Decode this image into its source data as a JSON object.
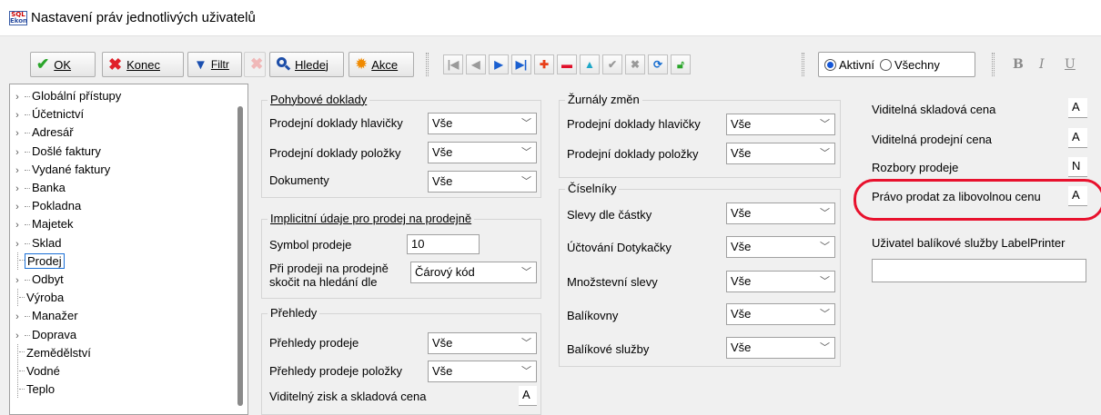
{
  "window": {
    "title": "Nastavení práv jednotlivých uživatelů",
    "app_icon_top": "SQL",
    "app_icon_bottom": "Ekon"
  },
  "toolbar": {
    "ok_label": "OK",
    "konec_label": "Konec",
    "filtr_label": "Filtr",
    "hledej_label": "Hledej",
    "akce_label": "Akce",
    "radio_aktivni": "Aktivní",
    "radio_vsechny": "Všechny",
    "format_bold": "B",
    "format_italic": "I",
    "format_underline": "U"
  },
  "tree": {
    "items": [
      {
        "label": "Globální přístupy",
        "expandable": true
      },
      {
        "label": "Účetnictví",
        "expandable": true
      },
      {
        "label": "Adresář",
        "expandable": true
      },
      {
        "label": "Došlé faktury",
        "expandable": true
      },
      {
        "label": "Vydané faktury",
        "expandable": true
      },
      {
        "label": "Banka",
        "expandable": true
      },
      {
        "label": "Pokladna",
        "expandable": true
      },
      {
        "label": "Majetek",
        "expandable": true
      },
      {
        "label": "Sklad",
        "expandable": true
      },
      {
        "label": "Prodej",
        "expandable": false,
        "selected": true
      },
      {
        "label": "Odbyt",
        "expandable": true
      },
      {
        "label": "Výroba",
        "expandable": false
      },
      {
        "label": "Manažer",
        "expandable": true
      },
      {
        "label": "Doprava",
        "expandable": true
      },
      {
        "label": "Zemědělství",
        "expandable": false
      },
      {
        "label": "Vodné",
        "expandable": false
      },
      {
        "label": "Teplo",
        "expandable": false
      }
    ]
  },
  "pohybove": {
    "title": "Pohybové doklady",
    "hlavicky_label": "Prodejní doklady hlavičky",
    "hlavicky_value": "Vše",
    "polozky_label": "Prodejní doklady položky",
    "polozky_value": "Vše",
    "dokumenty_label": "Dokumenty",
    "dokumenty_value": "Vše"
  },
  "implicitni": {
    "title": "Implicitní údaje pro prodej na prodejně",
    "symbol_label": "Symbol prodeje",
    "symbol_value": "10",
    "skocit_label_1": "Při prodeji na prodejně",
    "skocit_label_2": "skočit na hledání dle",
    "skocit_value": "Čárový kód"
  },
  "prehledy": {
    "title": "Přehledy",
    "prodeje_label": "Přehledy prodeje",
    "prodeje_value": "Vše",
    "polozky_label": "Přehledy prodeje položky",
    "polozky_value": "Vše",
    "zisk_label": "Viditelný zisk a skladová cena",
    "zisk_value": "A"
  },
  "zurnaly": {
    "title": "Žurnály změn",
    "hlavicky_label": "Prodejní doklady hlavičky",
    "hlavicky_value": "Vše",
    "polozky_label": "Prodejní doklady položky",
    "polozky_value": "Vše"
  },
  "ciselniky": {
    "title": "Číselníky",
    "slevy_castky_label": "Slevy dle částky",
    "slevy_castky_value": "Vše",
    "uctovani_label": "Účtování Dotykačky",
    "uctovani_value": "Vše",
    "mnozstevni_label": "Množstevní slevy",
    "mnozstevni_value": "Vše",
    "balikovny_label": "Balíkovny",
    "balikovny_value": "Vše",
    "balikove_label": "Balíkové služby",
    "balikove_value": "Vše"
  },
  "right": {
    "skladova_label": "Viditelná skladová cena",
    "skladova_value": "A",
    "prodejni_label": "Viditelná prodejní cena",
    "prodejni_value": "A",
    "rozbory_label": "Rozbory prodeje",
    "rozbory_value": "N",
    "libovolna_label": "Právo prodat za libovolnou cenu",
    "libovolna_value": "A",
    "labelprinter_label": "Uživatel balíkové služby LabelPrinter",
    "labelprinter_value": ""
  },
  "colors": {
    "highlight_ring": "#e8112d",
    "selection_border": "#1a6fd6",
    "radio_active": "#1456d6"
  }
}
